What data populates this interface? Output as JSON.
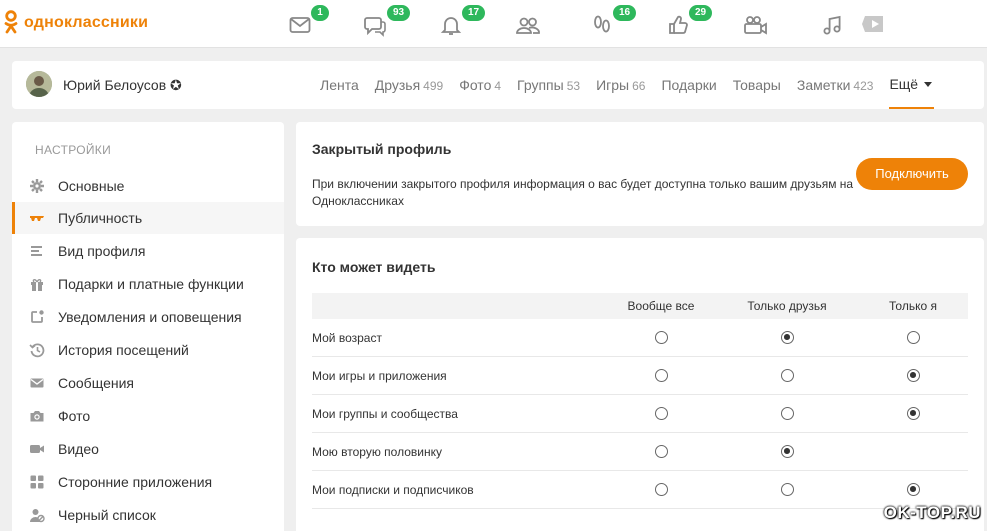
{
  "header": {
    "logo_text": "одноклассники",
    "nav": [
      {
        "icon": "envelope-icon",
        "badge": "1"
      },
      {
        "icon": "chat-icon",
        "badge": "93"
      },
      {
        "icon": "bell-icon",
        "badge": "17"
      },
      {
        "icon": "friends-icon",
        "badge": ""
      },
      {
        "icon": "footprints-icon",
        "badge": "16"
      },
      {
        "icon": "thumbs-up-icon",
        "badge": "29"
      },
      {
        "icon": "video-camera-icon",
        "badge": ""
      },
      {
        "icon": "music-note-icon",
        "badge": ""
      },
      {
        "icon": "play-icon",
        "badge": ""
      }
    ],
    "accent_color": "#ee8208",
    "badge_color": "#2eb85c"
  },
  "profile": {
    "name": "Юрий Белоусов ✪",
    "tabs": [
      {
        "label": "Лента",
        "count": ""
      },
      {
        "label": "Друзья",
        "count": "499"
      },
      {
        "label": "Фото",
        "count": "4"
      },
      {
        "label": "Группы",
        "count": "53"
      },
      {
        "label": "Игры",
        "count": "66"
      },
      {
        "label": "Подарки",
        "count": ""
      },
      {
        "label": "Товары",
        "count": ""
      },
      {
        "label": "Заметки",
        "count": "423"
      },
      {
        "label": "Ещё",
        "count": ""
      }
    ]
  },
  "sidebar": {
    "title": "НАСТРОЙКИ",
    "items": [
      {
        "label": "Основные",
        "icon": "gear-icon"
      },
      {
        "label": "Публичность",
        "icon": "glasses-icon"
      },
      {
        "label": "Вид профиля",
        "icon": "list-icon"
      },
      {
        "label": "Подарки и платные функции",
        "icon": "gift-icon"
      },
      {
        "label": "Уведомления и оповещения",
        "icon": "notification-icon"
      },
      {
        "label": "История посещений",
        "icon": "history-icon"
      },
      {
        "label": "Сообщения",
        "icon": "envelope-icon"
      },
      {
        "label": "Фото",
        "icon": "camera-icon"
      },
      {
        "label": "Видео",
        "icon": "video-icon"
      },
      {
        "label": "Сторонние приложения",
        "icon": "apps-icon"
      },
      {
        "label": "Черный список",
        "icon": "blacklist-icon"
      }
    ]
  },
  "private_profile": {
    "title": "Закрытый профиль",
    "description": "При включении закрытого профиля информация о вас будет доступна только вашим друзьям на Одноклассниках",
    "button": "Подключить"
  },
  "visibility": {
    "title": "Кто может видеть",
    "columns": [
      "Вообще все",
      "Только друзья",
      "Только я"
    ],
    "rows": [
      {
        "label": "Мой возраст",
        "options": 3,
        "selected": 1
      },
      {
        "label": "Мои игры и приложения",
        "options": 3,
        "selected": 2
      },
      {
        "label": "Мои группы и сообщества",
        "options": 3,
        "selected": 2
      },
      {
        "label": "Мою вторую половинку",
        "options": 2,
        "selected": 1
      },
      {
        "label": "Мои подписки и подписчиков",
        "options": 3,
        "selected": 2
      }
    ]
  },
  "watermark": "OK-TOP.RU"
}
